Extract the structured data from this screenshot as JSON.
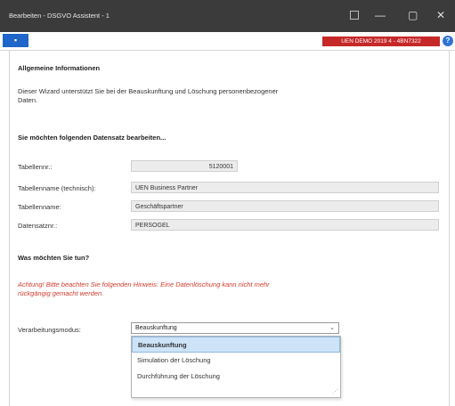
{
  "window": {
    "title": "Bearbeiten - DSGVO Assistent - 1",
    "minimize": "—",
    "maximize": "▢",
    "close": "✕"
  },
  "toolbar": {
    "nav_symbol": "▪",
    "database_badge": "UEN DEMO 2019 4 - 4BN7322",
    "help_symbol": "?"
  },
  "sections": {
    "general_heading": "Allgemeine Informationen",
    "general_text": "Dieser Wizard unterstützt Sie bei der Beauskunftung und Löschung personenbezogener Daten.",
    "record_heading": "Sie möchten folgenden Datensatz bearbeiten...",
    "action_heading": "Was möchten Sie tun?"
  },
  "record": {
    "fields": [
      {
        "label": "Tabellennr.:",
        "value": "5120001"
      },
      {
        "label": "Tabellenname (technisch):",
        "value": "UEN Business Partner"
      },
      {
        "label": "Tabellenname:",
        "value": "Geschäftspartner"
      },
      {
        "label": "Datensatznr.:",
        "value": "PERSOGEL"
      }
    ]
  },
  "warning": "Achtung! Bitte beachten Sie folgenden Hinweis: Eine Datenlöschung kann nicht mehr rückgängig gemacht werden.",
  "mode": {
    "label": "Verarbeitungsmodus:",
    "selected": "Beauskunftung",
    "chevron": "⌄",
    "options": [
      "Beauskunftung",
      "Simulation der Löschung",
      "Durchführung der Löschung"
    ]
  },
  "colors": {
    "titlebar": "#3b3b3b",
    "accent": "#1e66c9",
    "badge": "#c62828",
    "warning": "#d23b2b",
    "selection": "#cde3f7"
  }
}
